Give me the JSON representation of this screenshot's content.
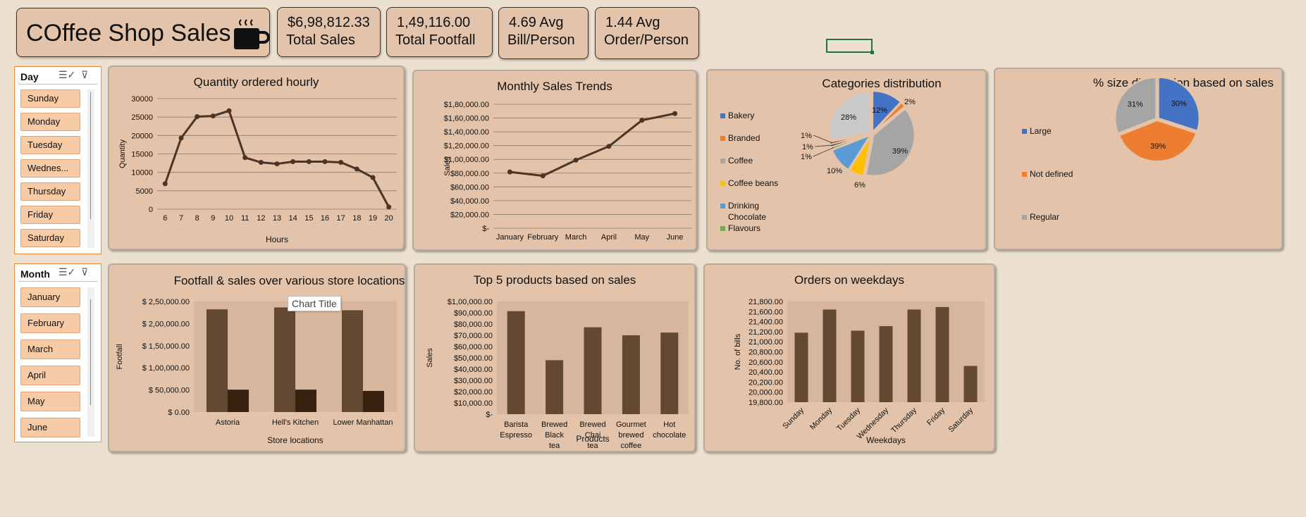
{
  "dashboard": {
    "title": "COffee Shop Sales",
    "icons": {
      "cup": "coffee-cup-icon"
    }
  },
  "kpis": [
    {
      "value": "$6,98,812.33",
      "label": "Total Sales"
    },
    {
      "value": "1,49,116.00",
      "label": "Total Footfall"
    },
    {
      "value": "4.69 Avg",
      "label": "Bill/Person"
    },
    {
      "value": "1.44 Avg",
      "label": "Order/Person"
    }
  ],
  "slicers": {
    "day": {
      "header": "Day",
      "items": [
        "Sunday",
        "Monday",
        "Tuesday",
        "Wednes...",
        "Thursday",
        "Friday",
        "Saturday"
      ]
    },
    "month": {
      "header": "Month",
      "items": [
        "January",
        "February",
        "March",
        "April",
        "May",
        "June"
      ]
    }
  },
  "tooltip": "Chart Title",
  "colors": {
    "bar": "#634832",
    "bar_dark": "#38220f",
    "line": "#4a3526",
    "blue": "#4472c4",
    "orange": "#ed7d31",
    "gray": "#a5a5a5",
    "gold": "#ffc000",
    "lightblue": "#5b9bd5",
    "green": "#70ad47",
    "panel": "#e3c3a9"
  },
  "chart_data": [
    {
      "id": "hourly",
      "type": "line",
      "title": "Quantity ordered hourly",
      "xlabel": "Hours",
      "ylabel": "Quantity",
      "x": [
        6,
        7,
        8,
        9,
        10,
        11,
        12,
        13,
        14,
        15,
        16,
        17,
        18,
        19,
        20
      ],
      "values": [
        6900,
        19300,
        25100,
        25300,
        26700,
        14000,
        12700,
        12300,
        12900,
        12900,
        12900,
        12700,
        10900,
        8600,
        600
      ],
      "yticks": [
        "0",
        "5000",
        "10000",
        "15000",
        "20000",
        "25000",
        "30000"
      ],
      "ylim": [
        0,
        30000
      ],
      "grid": true
    },
    {
      "id": "monthly",
      "type": "line",
      "title": "Monthly Sales Trends",
      "ylabel": "Sales",
      "categories": [
        "January",
        "February",
        "March",
        "April",
        "May",
        "June"
      ],
      "values": [
        81700,
        76100,
        98800,
        118900,
        156700,
        166500
      ],
      "yticks": [
        "$-",
        "$20,000.00",
        "$40,000.00",
        "$60,000.00",
        "$80,000.00",
        "$1,00,000.00",
        "$1,20,000.00",
        "$1,40,000.00",
        "$1,60,000.00",
        "$1,80,000.00"
      ],
      "ylim": [
        0,
        180000
      ],
      "grid": true
    },
    {
      "id": "categories",
      "type": "pie",
      "title": "Categories distribution",
      "legend": [
        "Bakery",
        "Branded",
        "Coffee",
        "Coffee beans",
        "Drinking Chocolate",
        "Flavours"
      ],
      "slices": [
        {
          "name": "Bakery",
          "value": 12,
          "label": "12%",
          "color": "#4472c4"
        },
        {
          "name": "Branded",
          "value": 2,
          "label": "2%",
          "color": "#ed7d31"
        },
        {
          "name": "Coffee",
          "value": 39,
          "label": "39%",
          "color": "#a5a5a5"
        },
        {
          "name": "Coffee beans",
          "value": 6,
          "label": "6%",
          "color": "#ffc000"
        },
        {
          "name": "Drinking Chocolate",
          "value": 10,
          "label": "10%",
          "color": "#5b9bd5"
        },
        {
          "name": "Flavours",
          "value": 1,
          "label": "1%",
          "color": "#70ad47"
        },
        {
          "name": "",
          "value": 1,
          "label": "1%",
          "color": "#264478"
        },
        {
          "name": "",
          "value": 1,
          "label": "1%",
          "color": "#9e480e"
        },
        {
          "name": "",
          "value": 28,
          "label": "28%",
          "color": "#c9c9c9"
        }
      ]
    },
    {
      "id": "size",
      "type": "pie",
      "title": "% size distribution based on sales",
      "legend": [
        "Large",
        "Not defined",
        "Regular"
      ],
      "slices": [
        {
          "name": "Large",
          "value": 30,
          "label": "30%",
          "color": "#4472c4"
        },
        {
          "name": "Not defined",
          "value": 39,
          "label": "39%",
          "color": "#ed7d31"
        },
        {
          "name": "Regular",
          "value": 31,
          "label": "31%",
          "color": "#a5a5a5"
        }
      ]
    },
    {
      "id": "footfall",
      "type": "bar",
      "title": "Footfall & sales over various store locations",
      "xlabel": "Store locations",
      "ylabel": "Footfall",
      "categories": [
        "Astoria",
        "Hell's Kitchen",
        "Lower Manhattan"
      ],
      "series": [
        {
          "values": [
            232200,
            236500,
            230100
          ]
        },
        {
          "values": [
            50600,
            50700,
            47800
          ]
        }
      ],
      "yticks": [
        "$ 0.00",
        "$ 50,000.00",
        "$ 1,00,000.00",
        "$ 1,50,000.00",
        "$ 2,00,000.00",
        "$ 2,50,000.00"
      ],
      "ylim": [
        0,
        250000
      ]
    },
    {
      "id": "top5",
      "type": "bar",
      "title": "Top 5 products based on sales",
      "xlabel": "Products",
      "ylabel": "Sales",
      "categories": [
        "Barista Espresso",
        "Brewed Black tea",
        "Brewed Chai tea",
        "Gourmet brewed coffee",
        "Hot chocolate"
      ],
      "values": [
        91400,
        47900,
        77100,
        70000,
        72400
      ],
      "yticks": [
        "$-",
        "$10,000.00",
        "$20,000.00",
        "$30,000.00",
        "$40,000.00",
        "$50,000.00",
        "$60,000.00",
        "$70,000.00",
        "$80,000.00",
        "$90,000.00",
        "$1,00,000.00"
      ],
      "ylim": [
        0,
        100000
      ]
    },
    {
      "id": "weekdays",
      "type": "bar",
      "title": "Orders on weekdays",
      "xlabel": "Weekdays",
      "ylabel": "No. of bills",
      "categories": [
        "Sunday",
        "Monday",
        "Tuesday",
        "Wednesday",
        "Thursday",
        "Friday",
        "Saturday"
      ],
      "values": [
        21180,
        21640,
        21220,
        21310,
        21640,
        21690,
        20520
      ],
      "yticks": [
        "19,800.00",
        "20,000.00",
        "20,200.00",
        "20,400.00",
        "20,600.00",
        "20,800.00",
        "21,000.00",
        "21,200.00",
        "21,400.00",
        "21,600.00",
        "21,800.00"
      ],
      "ylim": [
        19800,
        21800
      ]
    }
  ]
}
